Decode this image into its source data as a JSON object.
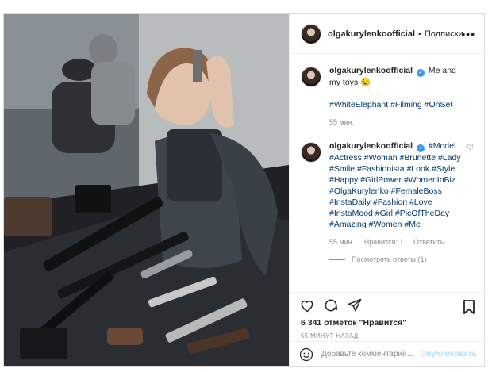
{
  "header": {
    "username": "olgakurylenkoofficial",
    "separator": "•",
    "follow_label": "Подписки",
    "more_icon": "more-horizontal-icon"
  },
  "caption": {
    "username": "olgakurylenkoofficial",
    "verified_mark": "✓",
    "text": "Me and my toys 😉",
    "tags": "#WhiteElephant #Filming #OnSet",
    "time": "55 мин."
  },
  "comment": {
    "username": "olgakurylenkoofficial",
    "verified_mark": "✓",
    "tags": "#Model #Actress #Woman #Brunette #Lady #Smile #Fashionista #Look #Style #Happy #GirlPower #WomenInBiz #OlgaKurylenko #FemaleBoss #InstaDaily #Fashion #Love #InstaMood #Girl #PicOfTheDay #Amazing #Women #Me",
    "time": "55 мин.",
    "likes": "Нравится: 1",
    "reply_label": "Ответить",
    "view_replies": "Посмотреть ответы (1)"
  },
  "likes_text": "6 341 отметок \"Нравится\"",
  "time_ago": "55 МИНУТ НАЗАД",
  "add_comment": {
    "placeholder": "Добавьте комментарий...",
    "post_label": "Опубликовать"
  },
  "colors": {
    "hashtag": "#00376b",
    "verified": "#3897f0",
    "muted": "#8e8e8e",
    "post_button": "#b2dffc"
  }
}
